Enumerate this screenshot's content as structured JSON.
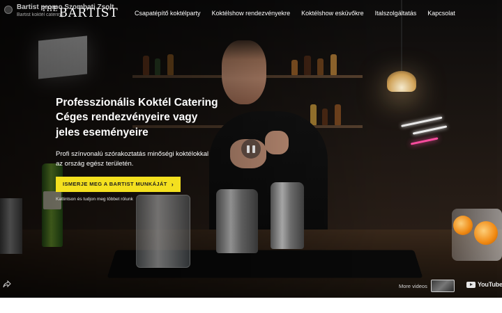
{
  "youtube_overlay": {
    "video_title": "Bartist promo Szombati Zsolt",
    "channel_name": "Bartist koktél catering",
    "more_videos_label": "More videos",
    "platform_logo_text": "YouTube",
    "icons": {
      "share": "share-arrow-icon",
      "pause": "pause-icon",
      "youtube": "youtube-play-icon"
    }
  },
  "header": {
    "logo_prefix": "THE",
    "logo_text": "BARTIST",
    "nav_items": [
      {
        "label": "Csapatépítő koktélparty"
      },
      {
        "label": "Koktélshow rendezvényekre"
      },
      {
        "label": "Koktélshow esküvőkre"
      },
      {
        "label": "Italszolgáltatás"
      },
      {
        "label": "Kapcsolat"
      }
    ]
  },
  "hero": {
    "title_line1": "Professzionális Koktél Catering",
    "title_line2": "Céges rendezvényeire vagy",
    "title_line3": "jeles eseményeire",
    "description": "Profi színvonalú szórakoztatás minőségi koktélokkal az ország egész területén.",
    "cta_label": "ISMERJE MEG A BARTIST MUNKÁJÁT",
    "cta_icon": "chevron-right-icon",
    "cta_note": "Kattintson és tudjon meg többet rólunk"
  },
  "colors": {
    "cta_background": "#f4e01f",
    "cta_text": "#1e1e1e",
    "text_primary": "#ffffff"
  }
}
